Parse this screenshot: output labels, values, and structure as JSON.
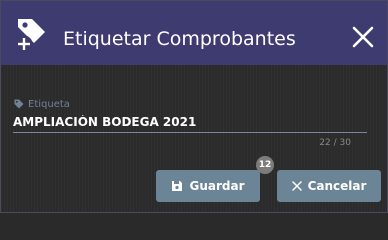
{
  "dialog": {
    "title": "Etiquetar Comprobantes",
    "header_icon": "tag-add-icon",
    "close_icon": "close-icon"
  },
  "form": {
    "field_label": "Etiqueta",
    "field_icon": "tag-icon",
    "field_value": "AMPLIACIÓN BODEGA 2021",
    "char_counter": "22 / 30"
  },
  "actions": {
    "save_label": "Guardar",
    "save_icon": "floppy-disk-icon",
    "save_badge": "12",
    "cancel_label": "Cancelar",
    "cancel_icon": "close-icon"
  },
  "colors": {
    "header_bg": "#3d3b70",
    "button_bg": "#6b8496",
    "label": "#6f8298"
  }
}
